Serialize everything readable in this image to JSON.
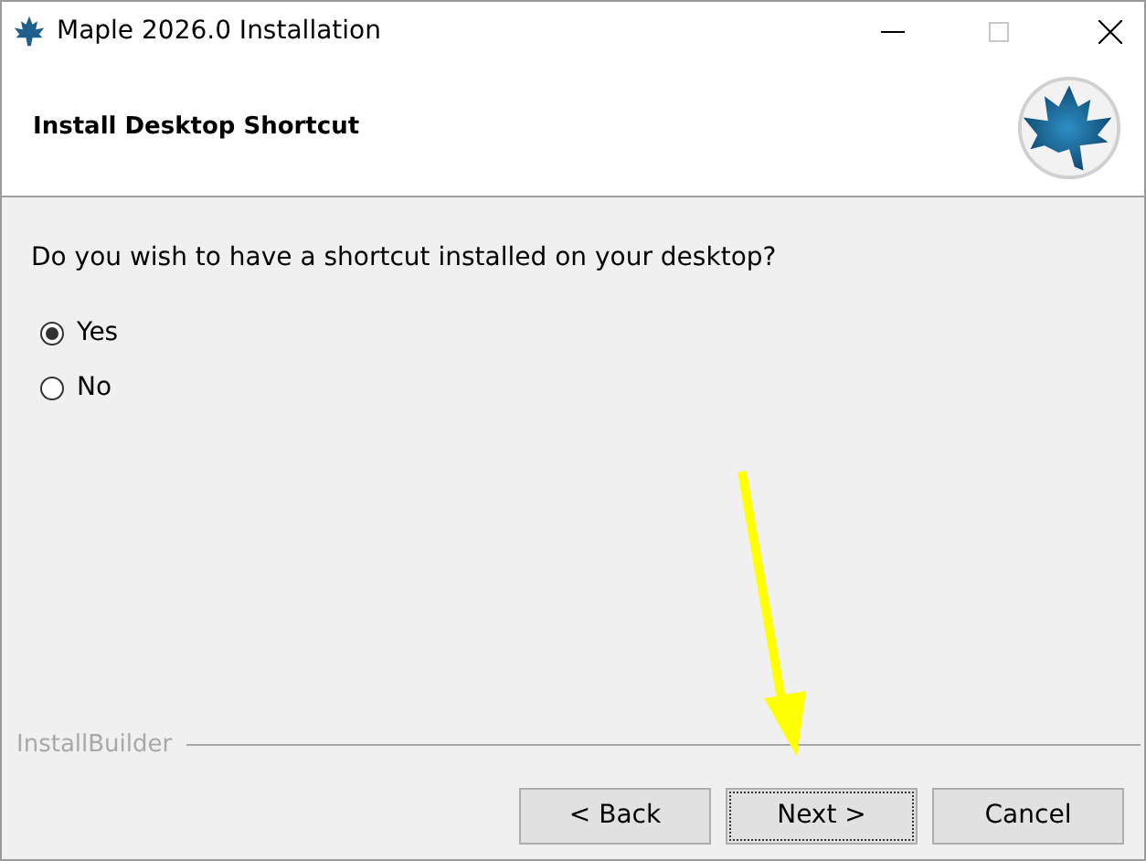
{
  "window": {
    "title": "Maple 2026.0 Installation"
  },
  "header": {
    "title": "Install Desktop Shortcut"
  },
  "question": "Do you wish to have a shortcut installed on your desktop?",
  "options": [
    {
      "label": "Yes",
      "selected": true
    },
    {
      "label": "No",
      "selected": false
    }
  ],
  "footer_label": "InstallBuilder",
  "buttons": [
    {
      "label": "< Back",
      "focused": false
    },
    {
      "label": "Next >",
      "focused": true
    },
    {
      "label": "Cancel",
      "focused": false
    }
  ]
}
